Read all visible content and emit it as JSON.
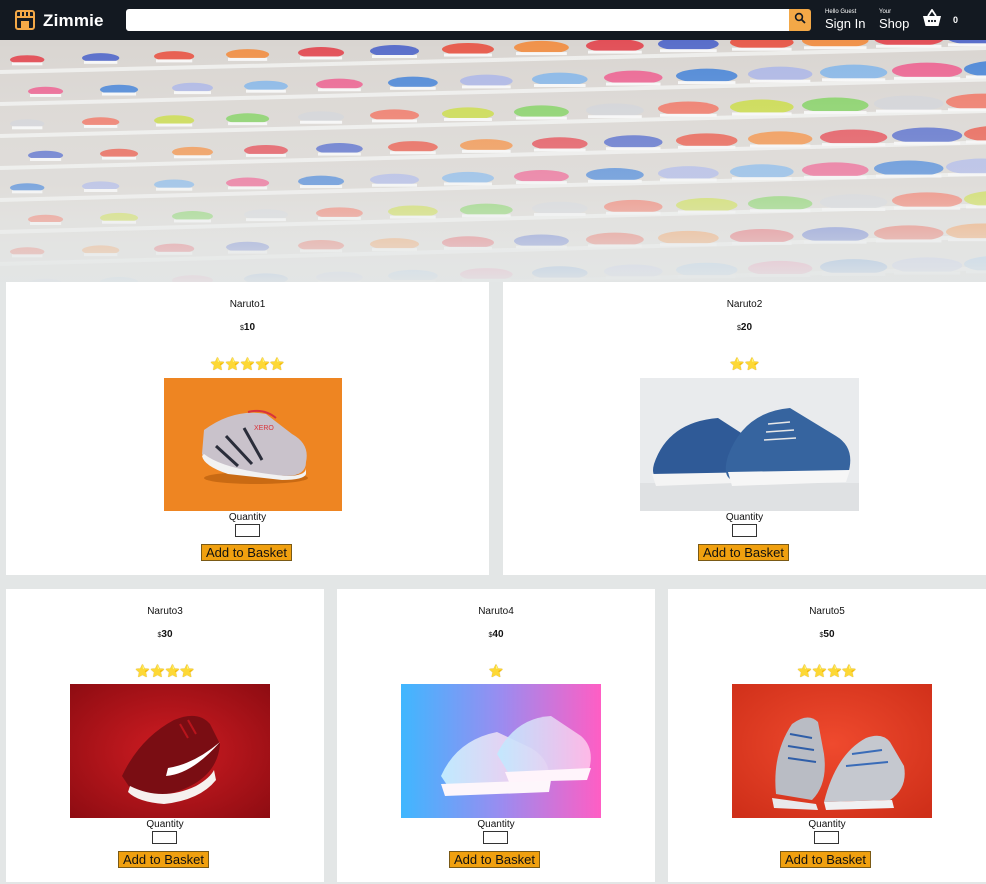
{
  "header": {
    "brand": "Zimmie",
    "search": {
      "value": "",
      "placeholder": ""
    },
    "sign_in": {
      "line1": "Hello Guest",
      "line2": "Sign In"
    },
    "shop": {
      "line1": "Your",
      "line2": "Shop"
    },
    "basket_count": "0"
  },
  "icons": {
    "logo": "storefront-icon",
    "search": "search-icon",
    "basket": "shopping-basket-icon"
  },
  "colors": {
    "header_bg": "#131921",
    "search_button": "#f3a847",
    "button_bg": "#f0a00f",
    "star": "#f4c21b"
  },
  "products": [
    {
      "title": "Naruto1",
      "currency": "$",
      "price": "10",
      "rating": 5,
      "stars": "⭐⭐⭐⭐⭐",
      "qty_label": "Quantity",
      "button": "Add to Basket",
      "image": "orange-background-sneaker"
    },
    {
      "title": "Naruto2",
      "currency": "$",
      "price": "20",
      "rating": 2,
      "stars": "⭐⭐",
      "qty_label": "Quantity",
      "button": "Add to Basket",
      "image": "blue-canvas-shoes"
    },
    {
      "title": "Naruto3",
      "currency": "$",
      "price": "30",
      "rating": 4,
      "stars": "⭐⭐⭐⭐",
      "qty_label": "Quantity",
      "button": "Add to Basket",
      "image": "red-running-shoe"
    },
    {
      "title": "Naruto4",
      "currency": "$",
      "price": "40",
      "rating": 1,
      "stars": "⭐",
      "qty_label": "Quantity",
      "button": "Add to Basket",
      "image": "neon-lit-white-sneakers"
    },
    {
      "title": "Naruto5",
      "currency": "$",
      "price": "50",
      "rating": 4,
      "stars": "⭐⭐⭐⭐",
      "qty_label": "Quantity",
      "button": "Add to Basket",
      "image": "grey-runners-on-red"
    }
  ]
}
